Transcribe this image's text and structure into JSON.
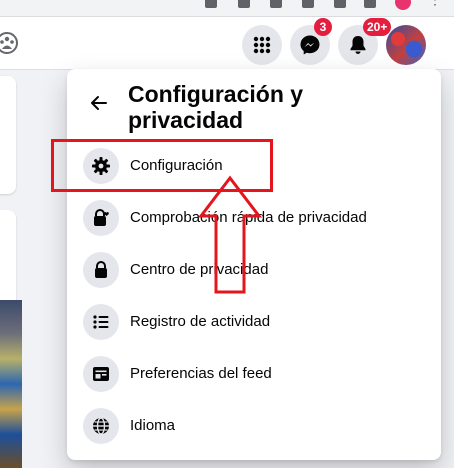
{
  "topbar": {
    "messenger_badge": "3",
    "notifications_badge": "20+"
  },
  "menu": {
    "title": "Configuración y privacidad",
    "items": [
      {
        "label": "Configuración",
        "icon": "gear-icon"
      },
      {
        "label": "Comprobación rápida de privacidad",
        "icon": "lock-heart-icon"
      },
      {
        "label": "Centro de privacidad",
        "icon": "lock-icon"
      },
      {
        "label": "Registro de actividad",
        "icon": "list-icon"
      },
      {
        "label": "Preferencias del feed",
        "icon": "feed-icon"
      },
      {
        "label": "Idioma",
        "icon": "globe-icon"
      }
    ]
  },
  "annotation": {
    "color": "#e4151d"
  },
  "colors": {
    "badge": "#e41e3f",
    "icon_bg": "#e4e6eb",
    "text": "#050505"
  }
}
